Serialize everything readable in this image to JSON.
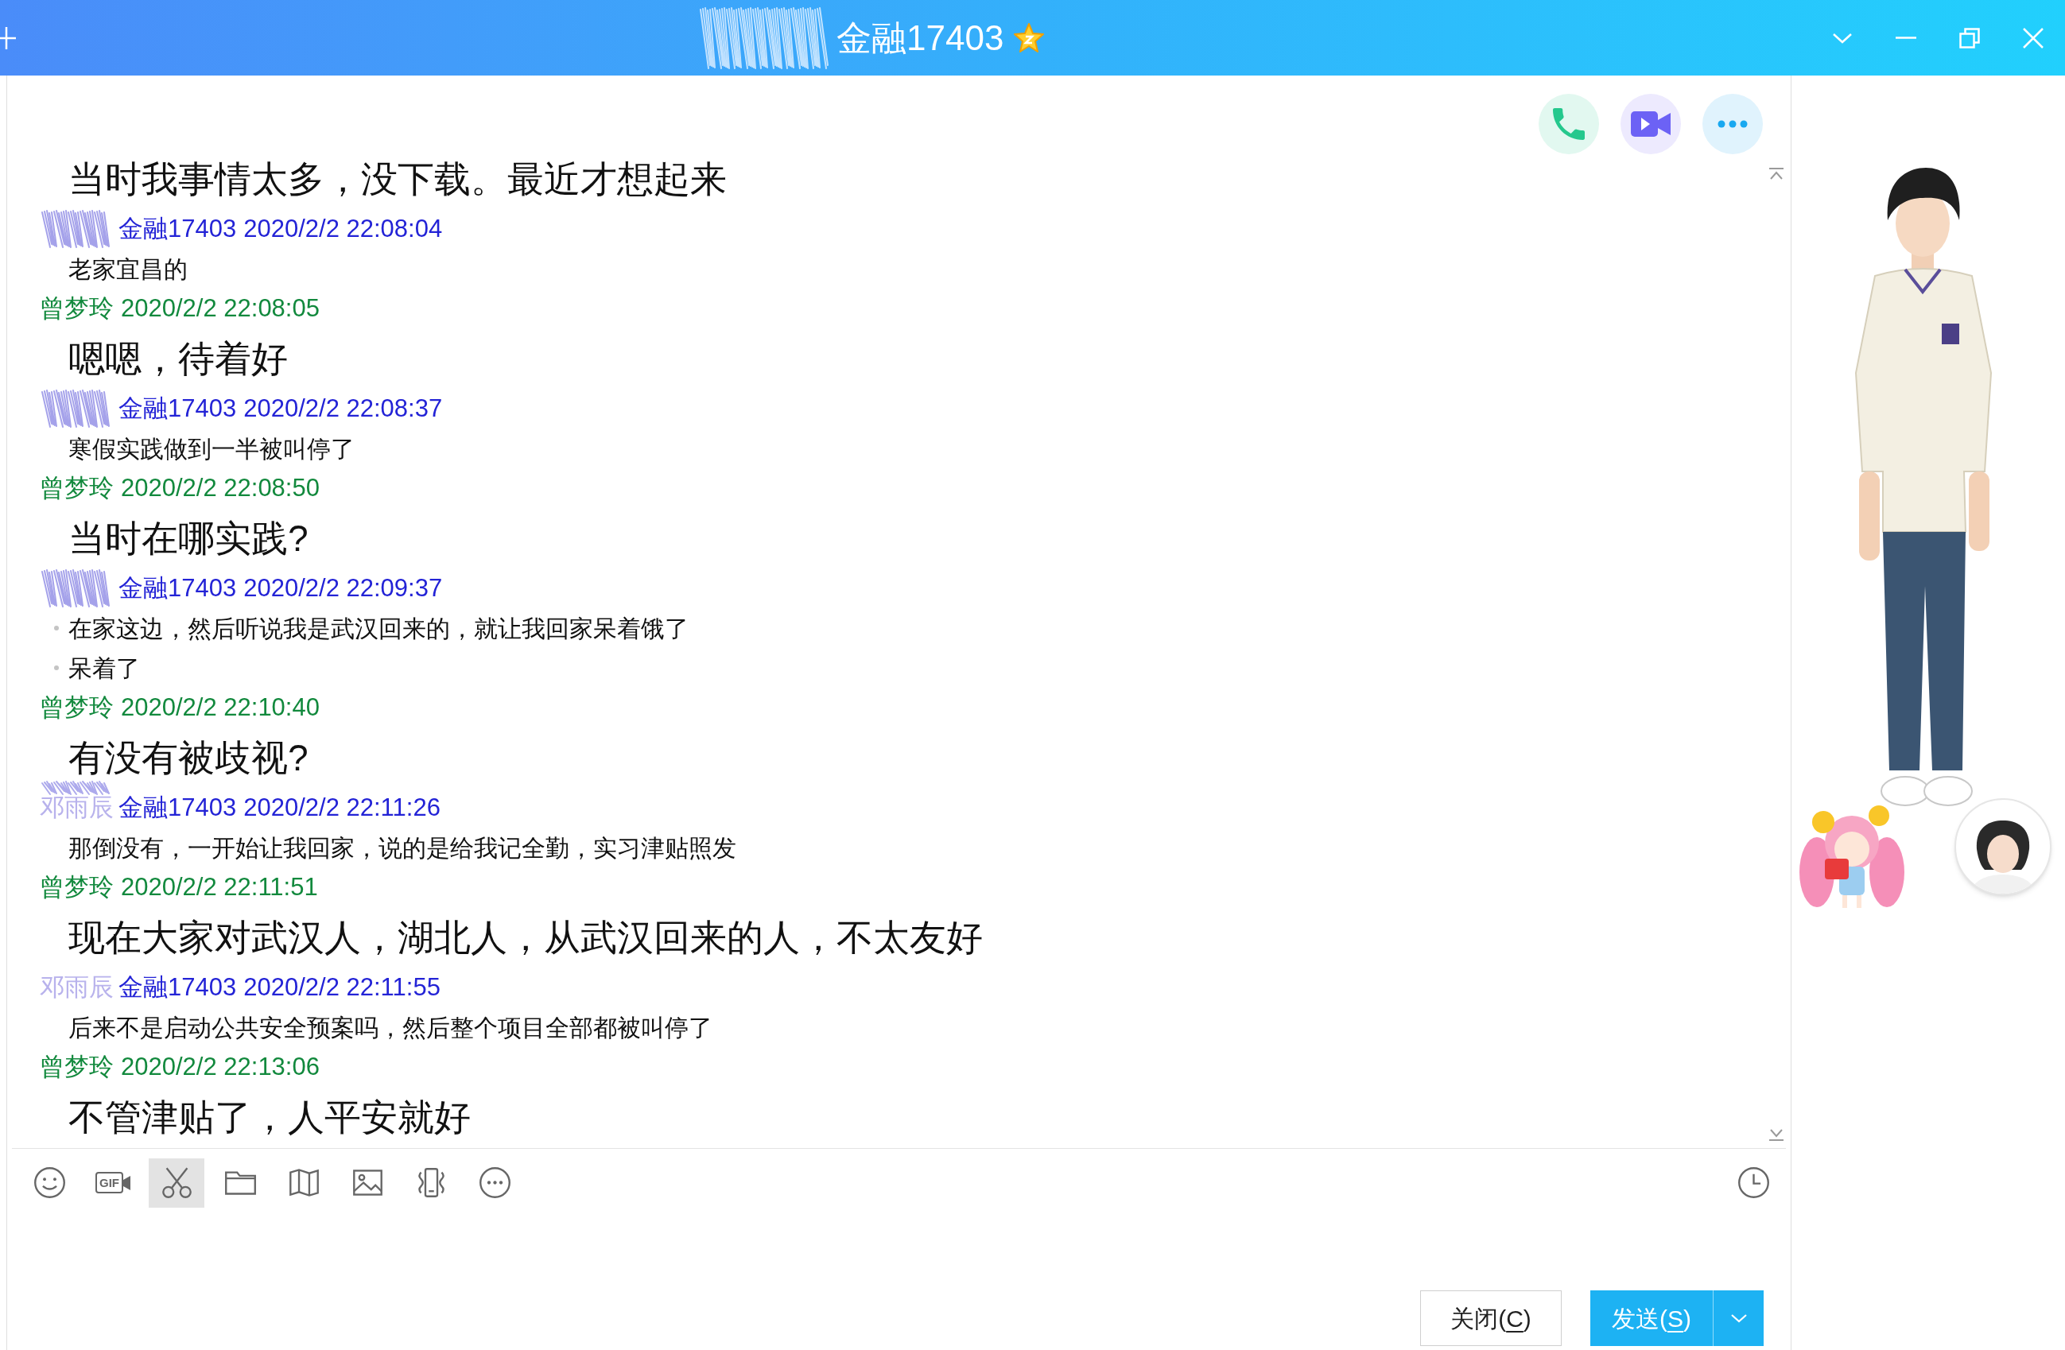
{
  "title_bar": {
    "title": "金融17403",
    "redacted": true
  },
  "call_actions": [
    {
      "kind": "voice"
    },
    {
      "kind": "video"
    },
    {
      "kind": "more"
    }
  ],
  "messages": [
    {
      "kind": "self",
      "bulleted": false,
      "lines": [
        "当时我事情太多，没下载。最近才想起来"
      ]
    },
    {
      "kind": "peer",
      "bulleted": false,
      "header": {
        "redacted": true,
        "sender": "金融17403",
        "time": "2020/2/2 22:08:04"
      },
      "lines": [
        "老家宜昌的"
      ]
    },
    {
      "kind": "self",
      "bulleted": false,
      "header": {
        "sender": "曾梦玲",
        "time": "2020/2/2 22:08:05"
      },
      "lines": [
        "嗯嗯，待着好"
      ]
    },
    {
      "kind": "peer",
      "bulleted": false,
      "header": {
        "redacted": true,
        "sender": "金融17403",
        "time": "2020/2/2 22:08:37"
      },
      "lines": [
        "寒假实践做到一半被叫停了"
      ]
    },
    {
      "kind": "self",
      "bulleted": false,
      "header": {
        "sender": "曾梦玲",
        "time": "2020/2/2 22:08:50"
      },
      "lines": [
        "当时在哪实践?"
      ]
    },
    {
      "kind": "peer",
      "bulleted": true,
      "header": {
        "redacted": true,
        "sender": "金融17403",
        "time": "2020/2/2 22:09:37"
      },
      "lines": [
        "在家这边，然后听说我是武汉回来的，就让我回家呆着饿了",
        "呆着了"
      ]
    },
    {
      "kind": "self",
      "bulleted": false,
      "header": {
        "sender": "曾梦玲",
        "time": "2020/2/2 22:10:40"
      },
      "lines": [
        "有没有被歧视?"
      ]
    },
    {
      "kind": "peer",
      "bulleted": false,
      "header": {
        "redacted": true,
        "alias": "邓雨辰",
        "sender": "金融17403",
        "time": "2020/2/2 22:11:26"
      },
      "lines": [
        "那倒没有，一开始让我回家，说的是给我记全勤，实习津贴照发"
      ]
    },
    {
      "kind": "self",
      "bulleted": false,
      "header": {
        "sender": "曾梦玲",
        "time": "2020/2/2 22:11:51"
      },
      "lines": [
        "现在大家对武汉人，湖北人，从武汉回来的人，不太友好"
      ]
    },
    {
      "kind": "peer",
      "bulleted": false,
      "header": {
        "redacted": false,
        "alias": "邓雨辰",
        "sender": "金融17403",
        "time": "2020/2/2 22:11:55"
      },
      "lines": [
        "后来不是启动公共安全预案吗，然后整个项目全部都被叫停了"
      ]
    },
    {
      "kind": "self",
      "bulleted": false,
      "header": {
        "sender": "曾梦玲",
        "time": "2020/2/2 22:13:06"
      },
      "lines": [
        "不管津贴了，人平安就好"
      ]
    }
  ],
  "toolbar": {
    "tools": [
      {
        "kind": "emoji",
        "active": false
      },
      {
        "kind": "gif",
        "label": "GIF",
        "active": false
      },
      {
        "kind": "screenshot",
        "active": true
      },
      {
        "kind": "file",
        "active": false
      },
      {
        "kind": "map",
        "active": false
      },
      {
        "kind": "image",
        "active": false
      },
      {
        "kind": "shake",
        "active": false
      },
      {
        "kind": "more",
        "active": false
      }
    ],
    "history": {
      "active": false
    }
  },
  "buttons": [
    {
      "kind": "close",
      "has_menu": false,
      "label": [
        {
          "text": "关闭(",
          "underlined": false
        },
        {
          "text": "C",
          "underlined": true
        },
        {
          "text": ")",
          "underlined": false
        }
      ]
    },
    {
      "kind": "send",
      "has_menu": true,
      "label": [
        {
          "text": "发送(",
          "underlined": false
        },
        {
          "text": "S",
          "underlined": true
        },
        {
          "text": ")",
          "underlined": false
        }
      ]
    }
  ]
}
